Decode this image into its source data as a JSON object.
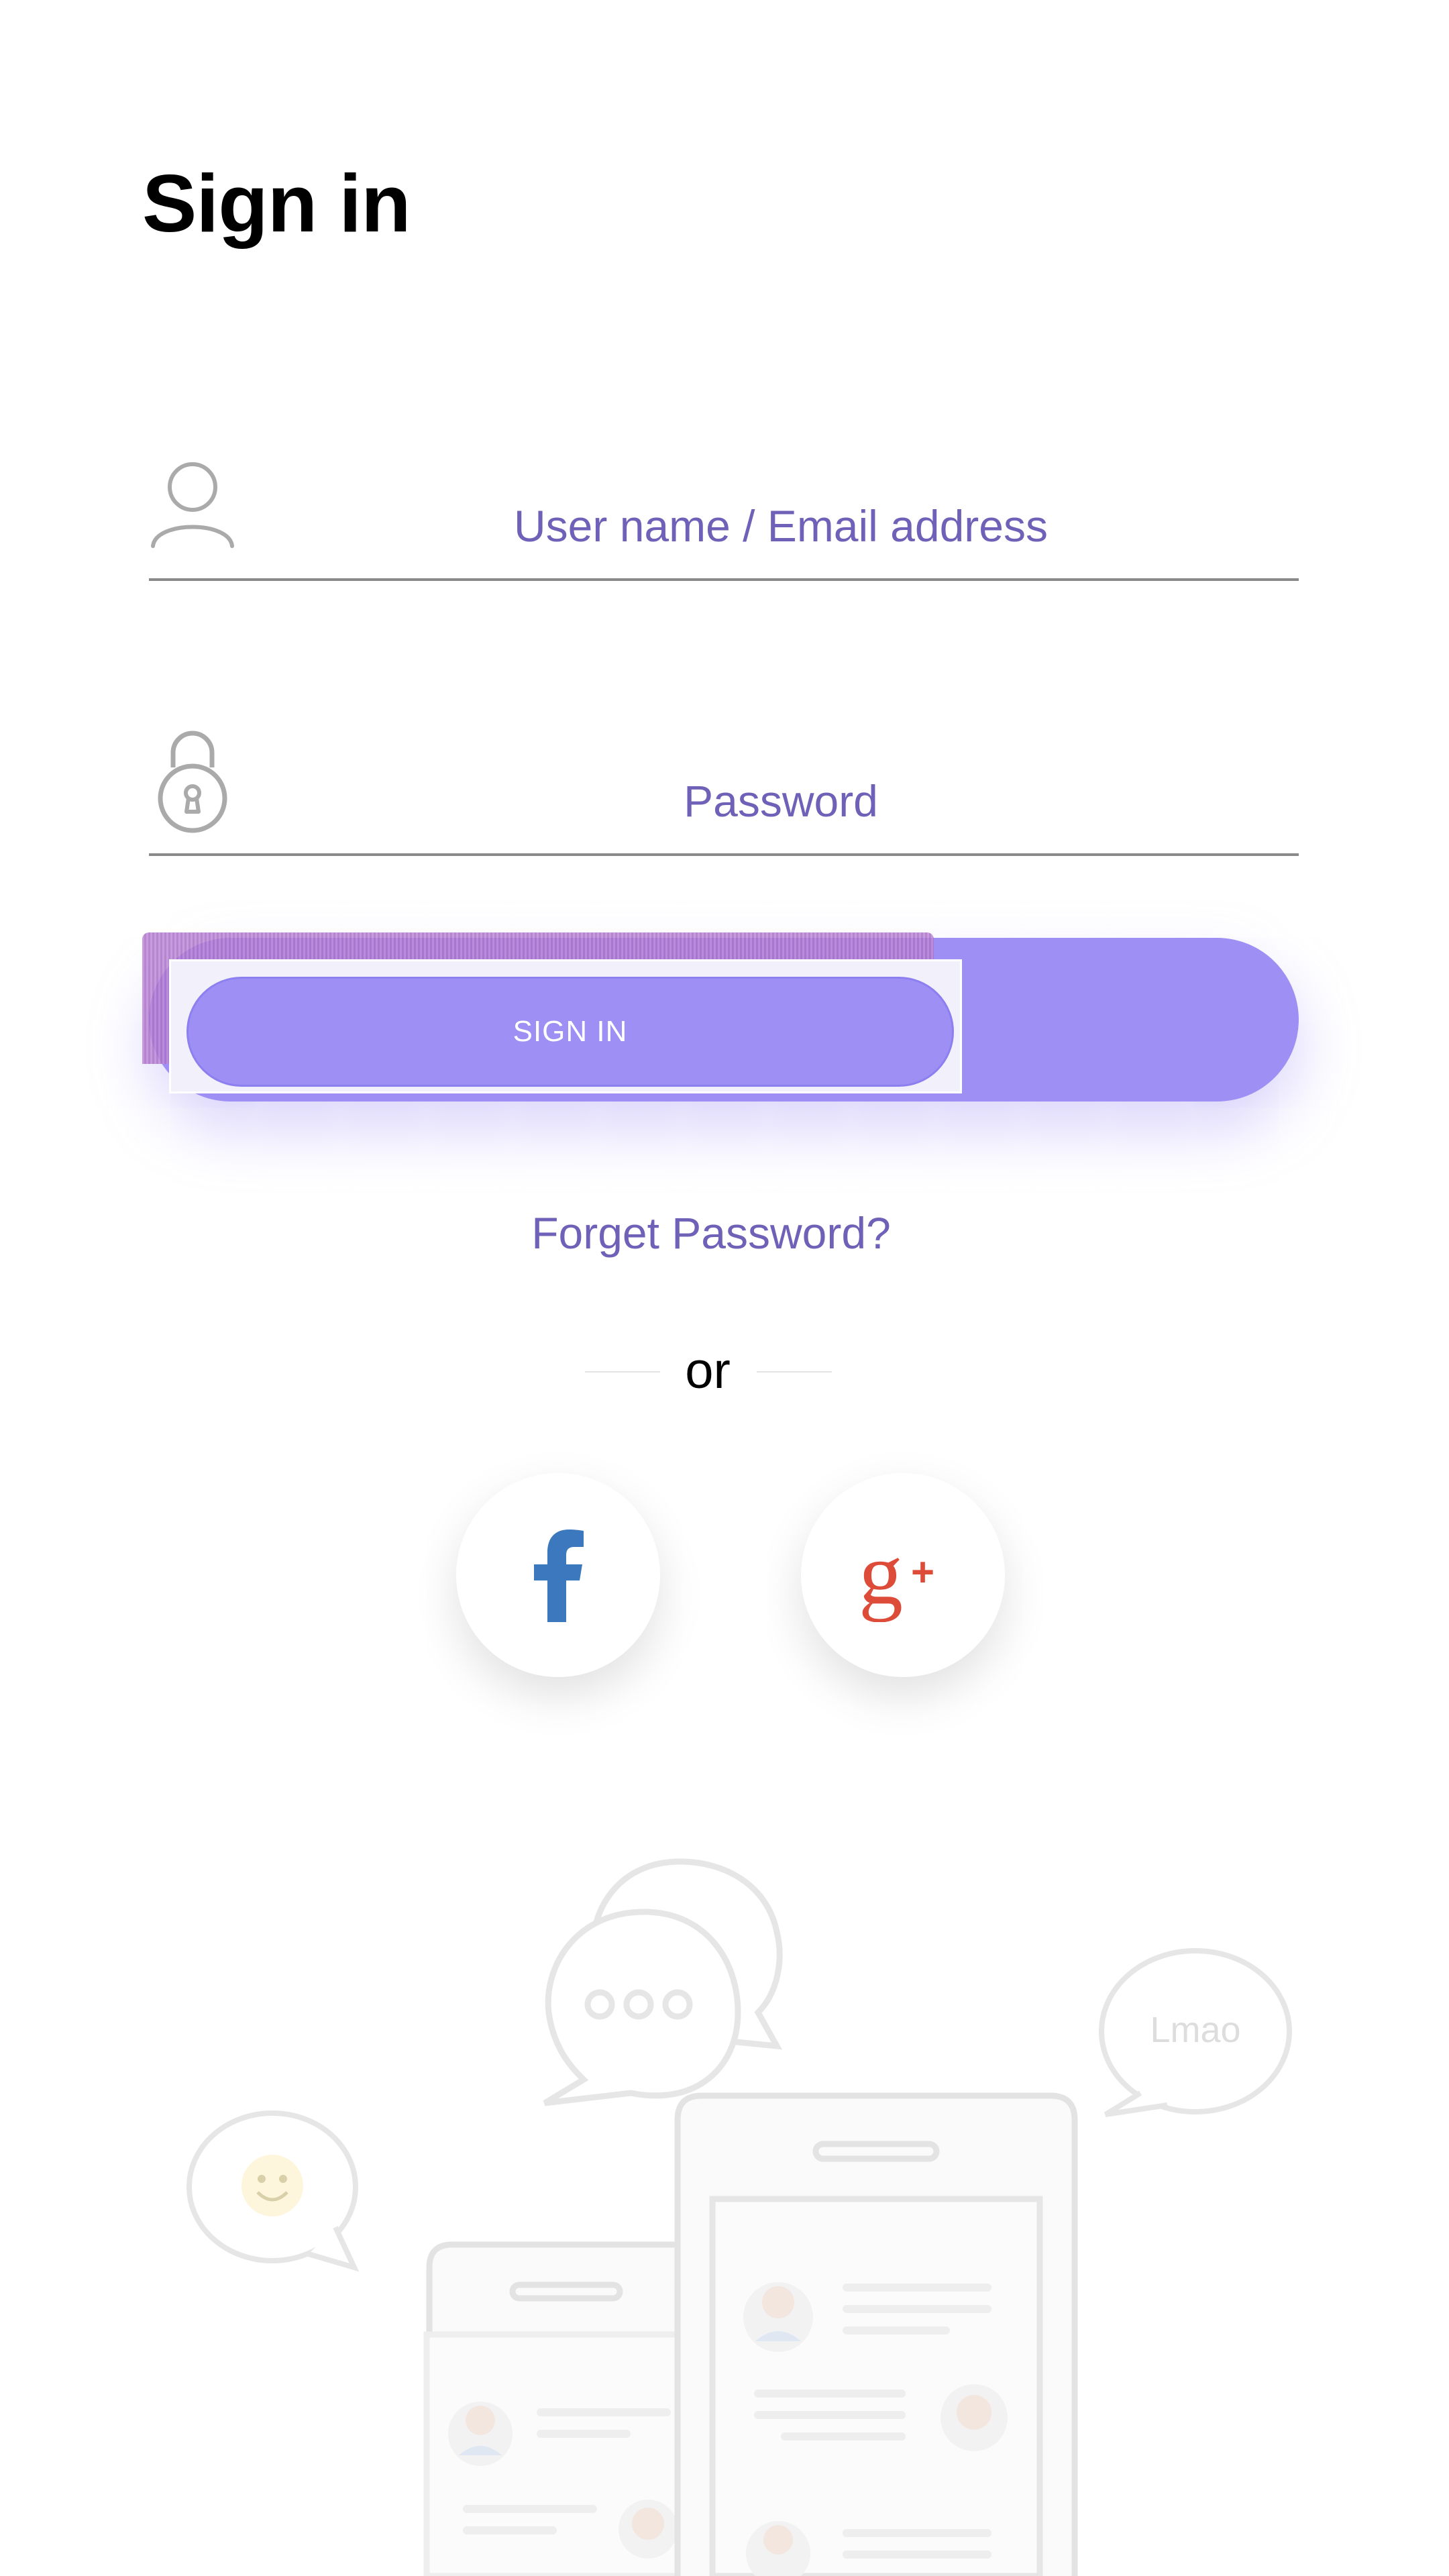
{
  "page": {
    "title": "Sign in"
  },
  "form": {
    "username_placeholder": "User name / Email address",
    "username_value": "",
    "password_placeholder": "Password",
    "password_value": "",
    "signin_label": "SIGN IN",
    "forgot_label": "Forget Password?",
    "or_label": "or"
  },
  "social": [
    {
      "icon": "facebook-icon"
    },
    {
      "icon": "google-plus-icon"
    }
  ],
  "illustration": {
    "bubble_text": "Lmao",
    "icons": [
      "chat-bubbles-icon",
      "emoji-bubble-icon",
      "phone-icon",
      "avatar-icon"
    ]
  },
  "colors": {
    "accent": "#9d8ff4",
    "link": "#6f61b7",
    "facebook": "#3b78bd",
    "google_plus": "#dd4b39"
  }
}
